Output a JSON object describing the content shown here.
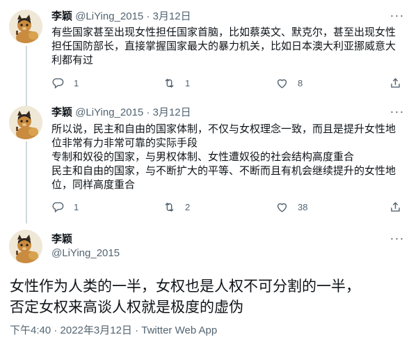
{
  "tweets": [
    {
      "name": "李颖",
      "handle": "@LiYing_2015",
      "sep": "·",
      "date": "3月12日",
      "more_label": "···",
      "text": [
        "有些国家甚至出现女性担任国家首脑，比如蔡英文、默克尔，甚至出现女性",
        "担任国防部长，直接掌握国家最大的暴力机关，比如日本澳大利亚挪威意大",
        "利都有过"
      ],
      "reply_count": "1",
      "retweet_count": "1",
      "like_count": "8"
    },
    {
      "name": "李颖",
      "handle": "@LiYing_2015",
      "sep": "·",
      "date": "3月12日",
      "more_label": "···",
      "text": [
        "所以说，民主和自由的国家体制，不仅与女权理念一致，而且是提升女性地",
        "位非常有力非常可靠的实际手段",
        "专制和奴役的国家，与男权体制、女性遭奴役的社会结构高度重合",
        "民主和自由的国家，与不断扩大的平等、不断而且有机会继续提升的女性地",
        "位，同样高度重合"
      ],
      "reply_count": "1",
      "retweet_count": "2",
      "like_count": "38"
    }
  ],
  "focus": {
    "name": "李颖",
    "handle": "@LiYing_2015",
    "more_label": "···",
    "text_line1": "女性作为人类的一半，女权也是人权不可分割的一半，",
    "text_line2": "否定女权来高谈人权就是极度的虚伪",
    "meta": "下午4:40 · 2022年3月12日 · Twitter Web App"
  },
  "icons": {
    "reply": "reply-icon",
    "retweet": "retweet-icon",
    "like": "heart-icon",
    "share": "share-icon",
    "more": "more-icon"
  },
  "colors": {
    "primary_text": "#0f1419",
    "secondary_text": "#536471",
    "thread_line": "#cfd9de"
  }
}
